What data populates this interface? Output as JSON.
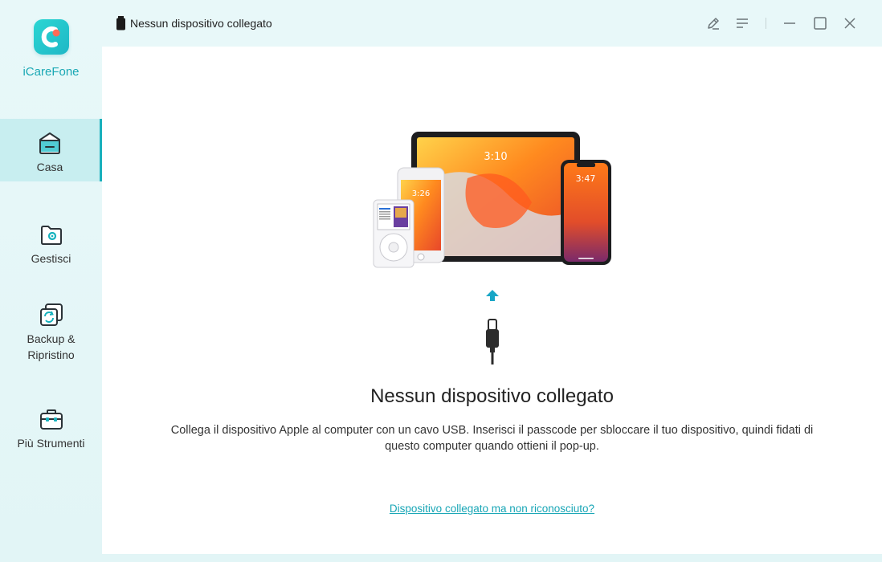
{
  "brand": {
    "name": "iCareFone",
    "accent": "#1aa8b4"
  },
  "sidebar": {
    "items": [
      {
        "label": "Casa",
        "icon": "home-icon",
        "active": true
      },
      {
        "label": "Gestisci",
        "icon": "manage-folder-icon",
        "active": false
      },
      {
        "label": "Backup &",
        "label2": "Ripristino",
        "icon": "backup-restore-icon",
        "active": false
      },
      {
        "label": "Più Strumenti",
        "icon": "toolbox-icon",
        "active": false
      }
    ]
  },
  "titlebar": {
    "status": "Nessun dispositivo collegato",
    "buttons": [
      "feedback-icon",
      "menu-icon",
      "minimize-icon",
      "maximize-icon",
      "close-icon"
    ]
  },
  "main": {
    "title": "Nessun dispositivo collegato",
    "description": "Collega il dispositivo Apple al computer con un cavo USB. Inserisci il passcode per sbloccare il tuo dispositivo, quindi fidati di questo computer quando ottieni il pop-up.",
    "help_link": "Dispositivo collegato ma non riconosciuto?",
    "device_times": {
      "ipad": "3:10",
      "ipod": "3:26",
      "iphone": "3:47"
    }
  }
}
